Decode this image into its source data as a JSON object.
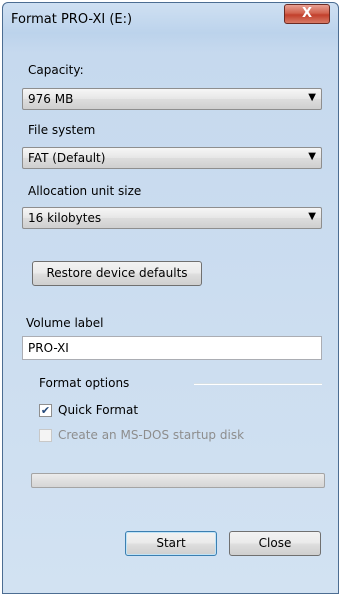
{
  "window": {
    "title": "Format PRO-XI (E:)",
    "close_label": "X"
  },
  "capacity": {
    "label": "Capacity:",
    "value": "976 MB"
  },
  "file_system": {
    "label": "File system",
    "value": "FAT (Default)"
  },
  "allocation": {
    "label": "Allocation unit size",
    "value": "16 kilobytes"
  },
  "restore_defaults_label": "Restore device defaults",
  "volume_label": {
    "label": "Volume label",
    "value": "PRO-XI"
  },
  "format_options": {
    "label": "Format options",
    "quick_format": {
      "label": "Quick Format",
      "checked": true,
      "enabled": true
    },
    "msdos_disk": {
      "label": "Create an MS-DOS startup disk",
      "checked": false,
      "enabled": false
    }
  },
  "progress": {
    "value": 0
  },
  "buttons": {
    "start": "Start",
    "close": "Close"
  },
  "icons": {
    "dropdown": "chevron-down-icon",
    "check": "checkmark-icon"
  }
}
